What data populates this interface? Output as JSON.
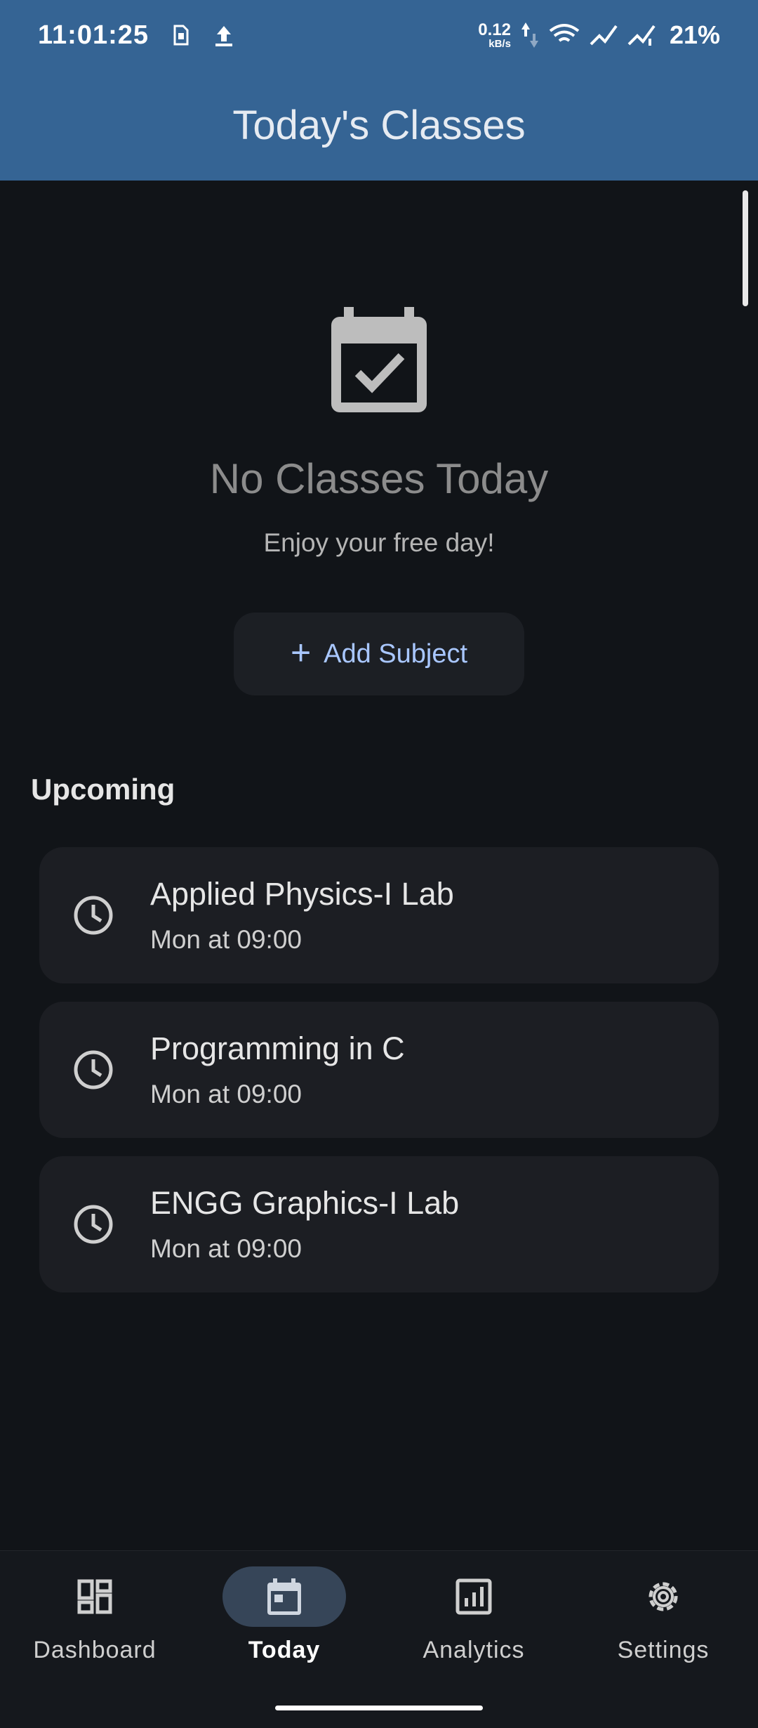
{
  "status_bar": {
    "time": "11:01:25",
    "net_speed_value": "0.12",
    "net_speed_unit": "kB/s",
    "battery": "21%"
  },
  "app_bar": {
    "title": "Today's Classes"
  },
  "empty_state": {
    "title": "No Classes Today",
    "subtitle": "Enjoy your free day!",
    "add_button_label": "Add Subject"
  },
  "upcoming": {
    "header": "Upcoming",
    "items": [
      {
        "name": "Applied Physics-I Lab",
        "time": "Mon at 09:00"
      },
      {
        "name": "Programming in C",
        "time": "Mon at 09:00"
      },
      {
        "name": "ENGG Graphics-I Lab",
        "time": "Mon at 09:00"
      }
    ]
  },
  "bottom_nav": {
    "items": [
      {
        "label": "Dashboard",
        "icon": "dashboard-icon"
      },
      {
        "label": "Today",
        "icon": "calendar-today-icon",
        "active": true
      },
      {
        "label": "Analytics",
        "icon": "analytics-icon"
      },
      {
        "label": "Settings",
        "icon": "settings-icon"
      }
    ]
  },
  "colors": {
    "app_bar": "#356494",
    "background": "#111418",
    "accent": "#a9c7ff",
    "card": "#1c1e23"
  }
}
